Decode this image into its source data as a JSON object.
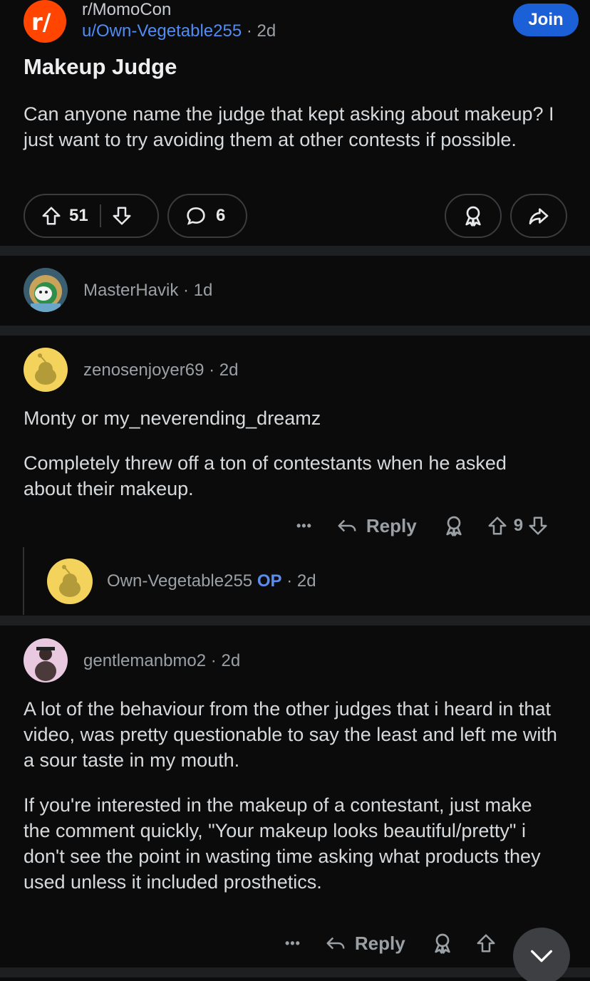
{
  "post": {
    "subreddit": "r/MomoCon",
    "author": "u/Own-Vegetable255",
    "time": "2d",
    "join_label": "Join",
    "title": "Makeup Judge",
    "body": "Can anyone name the judge that kept asking about makeup? I just want to try avoiding them at other contests if possible.",
    "upvotes": "51",
    "comments": "6"
  },
  "comments": [
    {
      "user": "MasterHavik",
      "time": "1d",
      "collapsed": true
    },
    {
      "user": "zenosenjoyer69",
      "time": "2d",
      "paragraphs": [
        "Monty or my_neverending_dreamz",
        "Completely threw off a ton of contestants when he asked about their makeup."
      ],
      "reply_label": "Reply",
      "votes": "9",
      "more": "•••"
    },
    {
      "user": "Own-Vegetable255",
      "op_label": "OP",
      "time": "2d",
      "collapsed": true
    },
    {
      "user": "gentlemanbmo2",
      "time": "2d",
      "paragraphs": [
        "A lot of the behaviour from the other judges that i heard in that video, was pretty questionable to say the least and left me with a sour taste in my mouth.",
        "If you're interested in the makeup of a contestant, just make the comment quickly, \"Your makeup looks beautiful/pretty\" i don't see the point in wasting time asking what products they used unless it included prosthetics."
      ],
      "reply_label": "Reply",
      "more": "•••"
    }
  ],
  "colors": {
    "accent": "#ff4500",
    "join": "#1c60d8",
    "op": "#5a8dee",
    "background": "#0b0b0c"
  },
  "icons": [
    "upvote-icon",
    "downvote-icon",
    "comment-icon",
    "award-icon",
    "share-icon",
    "reply-icon",
    "chevron-down-icon"
  ]
}
